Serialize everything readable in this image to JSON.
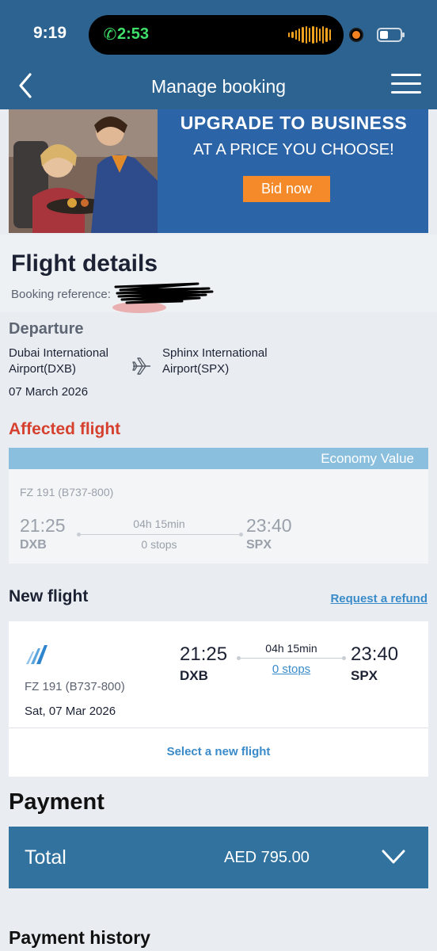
{
  "status_bar": {
    "time": "9:19",
    "call_duration": "2:53"
  },
  "header": {
    "title": "Manage booking"
  },
  "banner": {
    "title": "UPGRADE TO BUSINESS",
    "subtitle": "AT A PRICE YOU CHOOSE!",
    "button_label": "Bid now"
  },
  "flight_details": {
    "title": "Flight details",
    "booking_reference_label": "Booking reference:"
  },
  "departure": {
    "label": "Departure",
    "from": "Dubai International Airport(DXB)",
    "to": "Sphinx International Airport(SPX)",
    "date": "07 March 2026"
  },
  "affected_flight": {
    "label": "Affected flight",
    "cabin_class": "Economy Value",
    "flight_number": "FZ 191 (B737-800)",
    "departure_time": "21:25",
    "departure_code": "DXB",
    "duration": "04h 15min",
    "stops": "0 stops",
    "arrival_time": "23:40",
    "arrival_code": "SPX"
  },
  "new_flight": {
    "label": "New flight",
    "refund_link": "Request a refund",
    "flight_number": "FZ 191 (B737-800)",
    "date": "Sat, 07 Mar 2026",
    "departure_time": "21:25",
    "departure_code": "DXB",
    "duration": "04h 15min",
    "stops": "0 stops",
    "arrival_time": "23:40",
    "arrival_code": "SPX",
    "select_label": "Select a new flight"
  },
  "payment": {
    "label": "Payment",
    "total_label": "Total",
    "total_amount": "AED 795.00",
    "history_label": "Payment history"
  },
  "colors": {
    "header_bg": "#2d6390",
    "banner_bg": "#2c65a7",
    "bid_button": "#f58a2a",
    "affected_red": "#d6402f",
    "link_blue": "#3a8bc9",
    "total_bar": "#31729f",
    "class_header": "#8bbfde"
  },
  "icons": [
    "back-chevron-icon",
    "menu-icon",
    "phone-icon",
    "plane-icon",
    "airline-logo-icon",
    "chevron-down-icon"
  ]
}
